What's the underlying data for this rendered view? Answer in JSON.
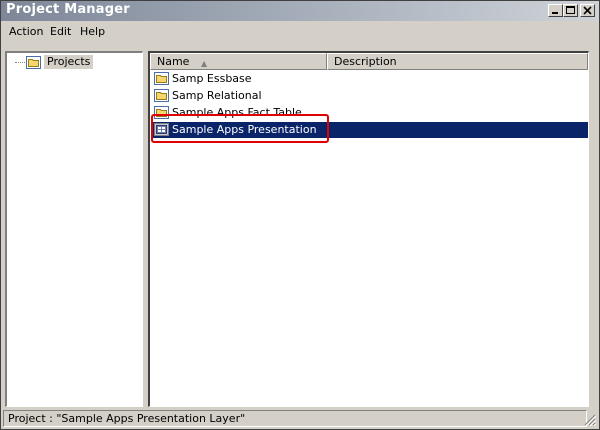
{
  "window": {
    "title": "Project Manager"
  },
  "menu": {
    "items": [
      {
        "label": "Action"
      },
      {
        "label": "Edit"
      },
      {
        "label": "Help"
      }
    ]
  },
  "tree": {
    "root_label": "Projects"
  },
  "list": {
    "columns": [
      {
        "label": "Name",
        "sort": "ascending"
      },
      {
        "label": "Description"
      }
    ],
    "rows": [
      {
        "name": "Samp Essbase",
        "icon": "folder-icon"
      },
      {
        "name": "Samp Relational",
        "icon": "folder-icon"
      },
      {
        "name": "Sample Apps Fact Table",
        "icon": "folder-icon"
      },
      {
        "name": "Sample Apps Presentation",
        "icon": "presentation-layer-icon",
        "selected": true
      }
    ]
  },
  "annotation": {
    "highlight_color": "#e00000"
  },
  "status": {
    "text": "Project : \"Sample Apps Presentation Layer\""
  },
  "colors": {
    "selection": "#0a246a",
    "chrome": "#d4d0c8"
  }
}
